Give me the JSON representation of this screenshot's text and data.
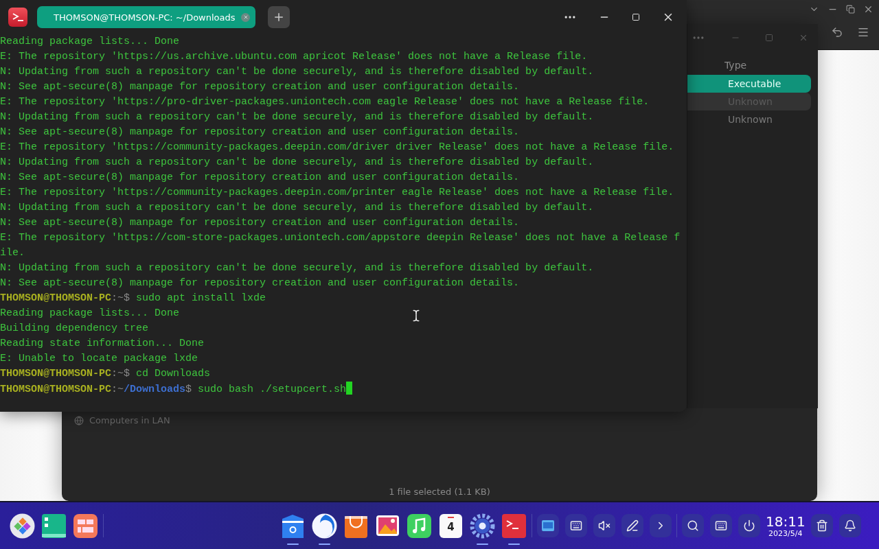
{
  "back_window": {
    "selected_count": "1 file selected (1.1 KB)",
    "sidebar": [
      {
        "label": "Computers in LAN"
      }
    ]
  },
  "properties": {
    "header": "Type",
    "rows": [
      {
        "label": "Executable",
        "selected": true,
        "hover": false
      },
      {
        "label": "Unknown",
        "selected": false,
        "hover": true
      },
      {
        "label": "Unknown",
        "selected": false,
        "hover": false
      }
    ]
  },
  "terminal": {
    "tabs": [
      {
        "title": "THOMSON@THOMSON-PC: ~/Downloads",
        "selected": true
      }
    ],
    "lines": [
      {
        "kind": "output",
        "text": "Reading package lists... Done"
      },
      {
        "kind": "output",
        "text": "E: The repository 'https://us.archive.ubuntu.com apricot Release' does not have a Release file."
      },
      {
        "kind": "output",
        "text": "N: Updating from such a repository can't be done securely, and is therefore disabled by default."
      },
      {
        "kind": "output",
        "text": "N: See apt-secure(8) manpage for repository creation and user configuration details."
      },
      {
        "kind": "output",
        "text": "E: The repository 'https://pro-driver-packages.uniontech.com eagle Release' does not have a Release file."
      },
      {
        "kind": "output",
        "text": "N: Updating from such a repository can't be done securely, and is therefore disabled by default."
      },
      {
        "kind": "output",
        "text": "N: See apt-secure(8) manpage for repository creation and user configuration details."
      },
      {
        "kind": "output",
        "text": "E: The repository 'https://community-packages.deepin.com/driver driver Release' does not have a Release file."
      },
      {
        "kind": "output",
        "text": "N: Updating from such a repository can't be done securely, and is therefore disabled by default."
      },
      {
        "kind": "output",
        "text": "N: See apt-secure(8) manpage for repository creation and user configuration details."
      },
      {
        "kind": "output",
        "text": "E: The repository 'https://community-packages.deepin.com/printer eagle Release' does not have a Release file."
      },
      {
        "kind": "output",
        "text": "N: Updating from such a repository can't be done securely, and is therefore disabled by default."
      },
      {
        "kind": "output",
        "text": "N: See apt-secure(8) manpage for repository creation and user configuration details."
      },
      {
        "kind": "output",
        "text": "E: The repository 'https://com-store-packages.uniontech.com/appstore deepin Release' does not have a Release file."
      },
      {
        "kind": "output",
        "text": "N: Updating from such a repository can't be done securely, and is therefore disabled by default."
      },
      {
        "kind": "output",
        "text": "N: See apt-secure(8) manpage for repository creation and user configuration details."
      },
      {
        "kind": "prompt",
        "parts": [
          {
            "kind": "user",
            "text": "THOMSON@THOMSON-PC"
          },
          {
            "kind": "punct",
            "text": ":~$"
          }
        ],
        "command": " sudo apt install lxde"
      },
      {
        "kind": "output",
        "text": "Reading package lists... Done"
      },
      {
        "kind": "output",
        "text": "Building dependency tree"
      },
      {
        "kind": "output",
        "text": "Reading state information... Done"
      },
      {
        "kind": "output",
        "text": "E: Unable to locate package lxde"
      },
      {
        "kind": "prompt",
        "parts": [
          {
            "kind": "user",
            "text": "THOMSON@THOMSON-PC"
          },
          {
            "kind": "punct",
            "text": ":~$"
          }
        ],
        "command": " cd Downloads"
      },
      {
        "kind": "prompt",
        "parts": [
          {
            "kind": "user",
            "text": "THOMSON@THOMSON-PC"
          },
          {
            "kind": "punct",
            "text": ":~"
          },
          {
            "kind": "dir",
            "text": "/Downloads"
          },
          {
            "kind": "punct",
            "text": "$"
          }
        ],
        "command": " sudo bash ./setupcert.sh",
        "cursor": true
      }
    ]
  },
  "dock": {
    "left": [
      {
        "kind": "launcher"
      },
      {
        "kind": "multitask"
      },
      {
        "kind": "widgets"
      }
    ],
    "apps": [
      {
        "kind": "files",
        "running": true
      },
      {
        "kind": "browser",
        "running": true
      },
      {
        "kind": "store",
        "running": false
      },
      {
        "kind": "photos",
        "running": false
      },
      {
        "kind": "music",
        "running": false
      },
      {
        "kind": "calendar",
        "running": false,
        "label": "4"
      },
      {
        "kind": "settings",
        "running": true
      },
      {
        "kind": "terminal",
        "running": true
      }
    ],
    "tray": [
      {
        "kind": "screenshot"
      },
      {
        "kind": "keyboard-light"
      },
      {
        "kind": "muted"
      },
      {
        "kind": "pen"
      },
      {
        "kind": "expand"
      }
    ],
    "system": [
      {
        "kind": "search"
      },
      {
        "kind": "keyboard"
      },
      {
        "kind": "power"
      }
    ],
    "time": "18:11",
    "date": "2023/5/4"
  }
}
